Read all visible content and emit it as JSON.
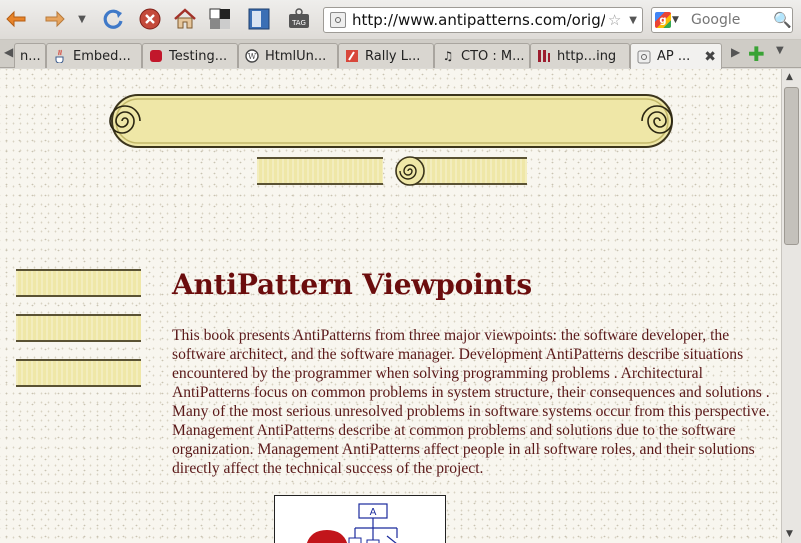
{
  "browser": {
    "url": "http://www.antipatterns.com/orig/ca",
    "search": {
      "placeholder": "Google",
      "engine_letter": "g"
    },
    "nav_icons": [
      "back-icon",
      "forward-icon",
      "history-dropdown-icon",
      "reload-icon",
      "stop-icon",
      "home-icon",
      "delicious-icon",
      "bookmark-icon",
      "tag-icon"
    ],
    "tag_label": "TAG",
    "tabs": [
      {
        "label": "n...",
        "icon": "none"
      },
      {
        "label": "Embed...",
        "icon": "java-icon"
      },
      {
        "label": "Testing...",
        "icon": "red-icon"
      },
      {
        "label": "HtmlUn...",
        "icon": "wordpress-icon"
      },
      {
        "label": "Rally L...",
        "icon": "rally-icon"
      },
      {
        "label": "CTO : M...",
        "icon": "music-icon"
      },
      {
        "label": "http...ing",
        "icon": "red-stripes-icon"
      },
      {
        "label": "AP ...",
        "icon": "page-icon",
        "active": true
      }
    ]
  },
  "page": {
    "heading": "AntiPattern Viewpoints",
    "body": "This book presents AntiPatterns from three major viewpoints: the software developer, the software architect, and the software manager. Development AntiPatterns describe situations encountered by the programmer when solving programming problems . Architectural AntiPatterns focus on common problems in system structure, their consequences and solutions . Many of the most serious unresolved problems in software systems occur from this perspective. Management AntiPatterns describe at common problems and solutions due to the software organization. Management AntiPatterns affect people in all software roles, and their solutions directly affect the technical success of the project.",
    "figure_label": "A"
  }
}
